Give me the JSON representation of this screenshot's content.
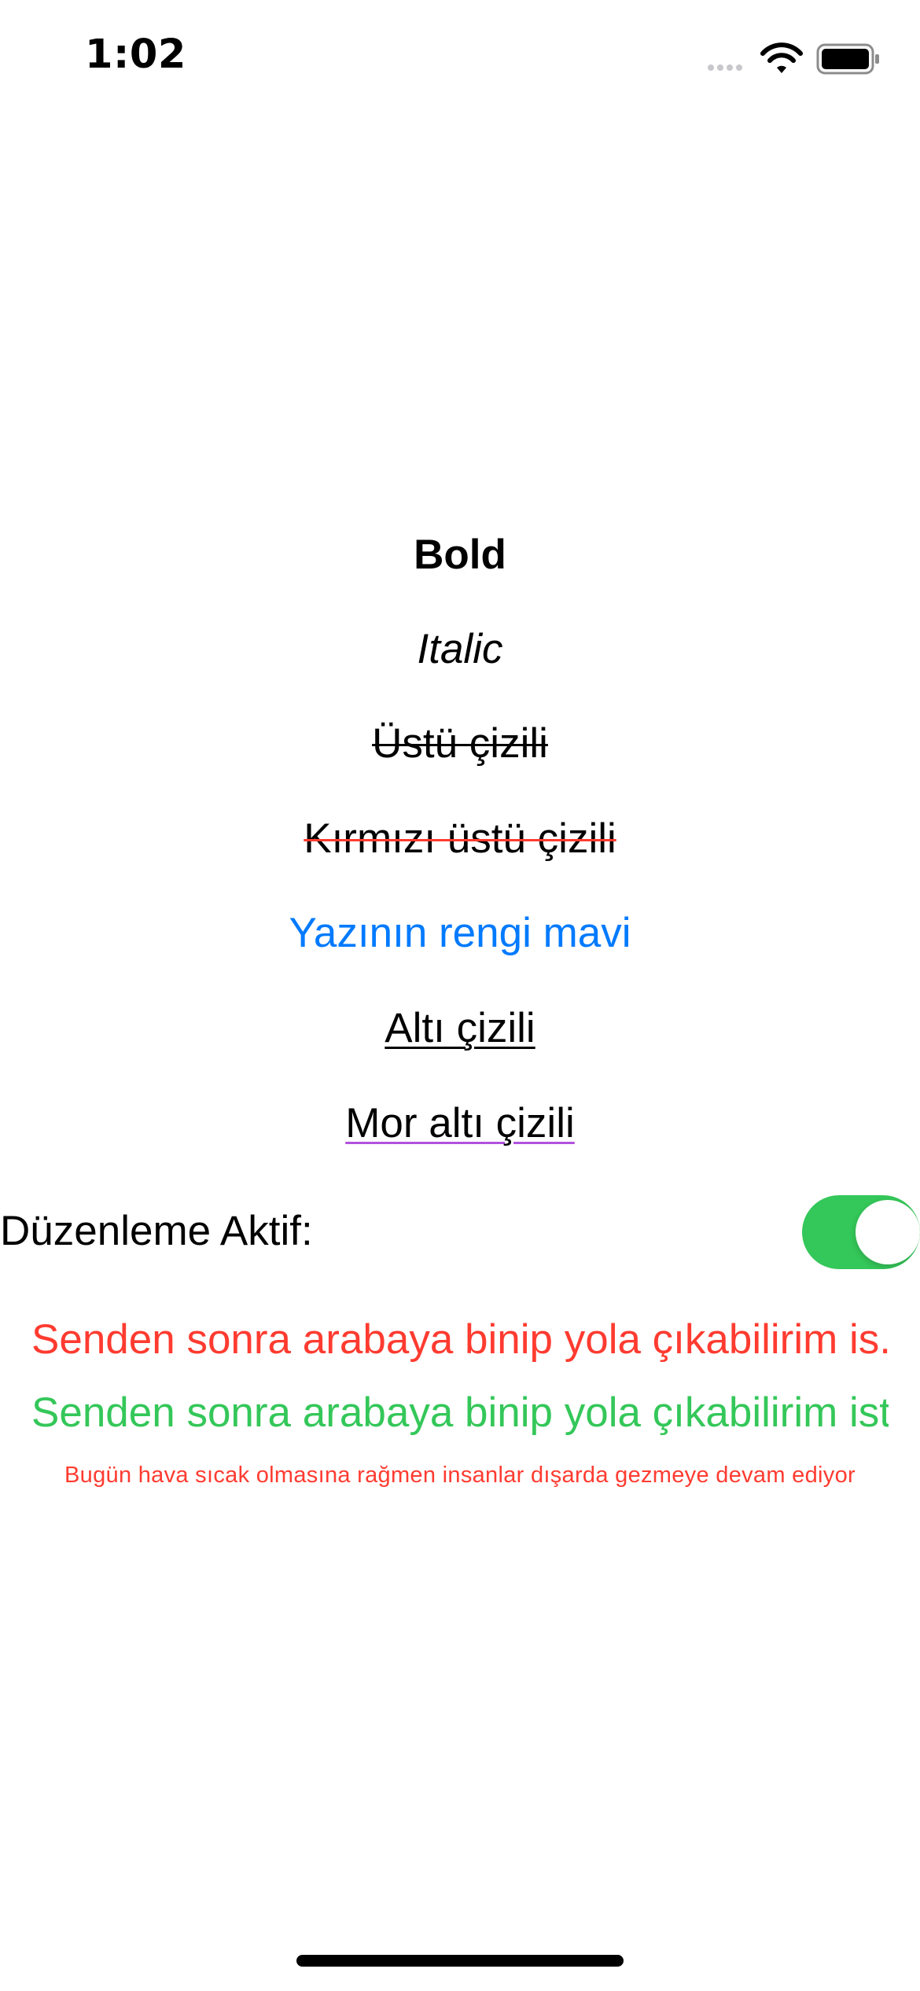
{
  "status_bar": {
    "time": "1:02",
    "icons": [
      "signal-icon",
      "wifi-icon",
      "battery-icon"
    ]
  },
  "styled_texts": {
    "bold": "Bold",
    "italic": "Italic",
    "strikethrough": "Üstü çizili",
    "red_strikethrough": "Kırmızı üstü çizili",
    "blue_text": "Yazının rengi mavi",
    "underline": "Altı çizili",
    "purple_underline": "Mor altı çizili"
  },
  "toggle": {
    "label": "Düzenleme Aktif:",
    "state": "on"
  },
  "truncated_texts": {
    "red_long": "Senden sonra arabaya binip yola çıkabilirim is...",
    "green_long": "Senden sonra arabaya binip yola çıkabilirim ist...",
    "small_red": "Bugün hava sıcak olmasına rağmen insanlar dışarda gezmeye devam ediyor"
  },
  "colors": {
    "red": "#ff3b30",
    "blue": "#007aff",
    "green": "#34c759",
    "purple": "#af52de",
    "toggle_on": "#34c759"
  }
}
